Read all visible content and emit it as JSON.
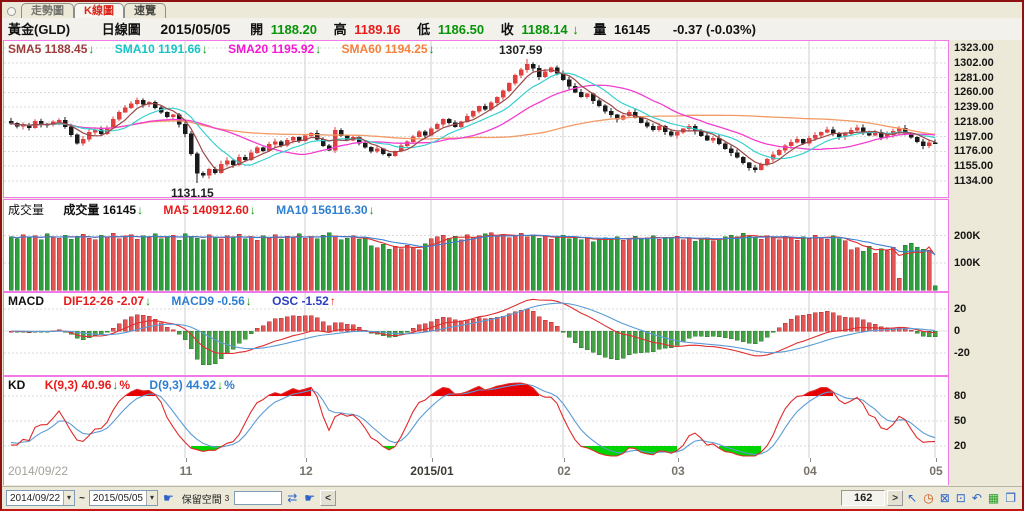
{
  "tabs": [
    {
      "label": "走勢圖",
      "active": false
    },
    {
      "label": "K線圖",
      "active": true
    },
    {
      "label": "速覽",
      "active": false
    }
  ],
  "header": {
    "symbol": "黃金(GLD)",
    "period": "日線圖",
    "date": "2015/05/05",
    "open_label": "開",
    "open": "1188.20",
    "high_label": "高",
    "high": "1189.16",
    "low_label": "低",
    "low": "1186.50",
    "close_label": "收",
    "close": "1188.14",
    "volume_label": "量",
    "volume": "16145",
    "change": "-0.37 (-0.03%)"
  },
  "arrows": {
    "down": "↓",
    "up": "↑"
  },
  "main_panel": {
    "sma5": "SMA5 1188.45",
    "sma10": "SMA10 1191.66",
    "sma20": "SMA20 1195.92",
    "sma60": "SMA60 1194.25",
    "high_annotation": "1307.59",
    "low_annotation": "1131.15",
    "price_ticks": [
      "1323.00",
      "1302.00",
      "1281.00",
      "1260.00",
      "1239.00",
      "1218.00",
      "1197.00",
      "1176.00",
      "1155.00",
      "1134.00"
    ]
  },
  "volume_panel": {
    "title": "成交量",
    "vol_label": "成交量 16145",
    "ma5_label": "MA5 140912.60",
    "ma10_label": "MA10 156116.30",
    "ticks": [
      "200K",
      "100K"
    ]
  },
  "macd_panel": {
    "title": "MACD",
    "dif_label": "DIF12-26 -2.07",
    "macd9_label": "MACD9 -0.56",
    "osc_label": "OSC -1.52",
    "ticks": [
      "20",
      "0",
      "-20"
    ]
  },
  "kd_panel": {
    "title": "KD",
    "k_label": "K(9,3) 40.96",
    "d_label": "D(9,3) 44.92",
    "pct": "%",
    "ticks": [
      "80",
      "50",
      "20"
    ]
  },
  "xaxis": {
    "start_label": "2014/09/22",
    "month_labels": [
      "11",
      "12",
      "2015/01",
      "02",
      "03",
      "04",
      "05"
    ]
  },
  "statusbar": {
    "date_from": "2014/09/22",
    "range_separator": "~",
    "date_to": "2015/05/05",
    "reserve_label": "保留空間",
    "reserve_superscript": "3",
    "back_button": "<",
    "bar_count": "162",
    "next_button": ">",
    "left_icons": [
      {
        "name": "hand-icon",
        "glyph": "☛",
        "color": "#2d62c9"
      },
      {
        "name": "swap-icon",
        "glyph": "⇄",
        "color": "#2d62c9"
      },
      {
        "name": "hand-icon-2",
        "glyph": "☛",
        "color": "#2d62c9"
      }
    ],
    "right_icons": [
      {
        "name": "cursor-icon",
        "glyph": "↖",
        "color": "#1d49c9"
      },
      {
        "name": "clock-icon",
        "glyph": "◷",
        "color": "#c9561d"
      },
      {
        "name": "zoom-out-icon",
        "glyph": "⊠",
        "color": "#1d49c9"
      },
      {
        "name": "zoom-in-icon",
        "glyph": "⊡",
        "color": "#1d49c9"
      },
      {
        "name": "undo-icon",
        "glyph": "↶",
        "color": "#1d49c9"
      },
      {
        "name": "chart-icon",
        "glyph": "▦",
        "color": "#259d25"
      },
      {
        "name": "copy-icon",
        "glyph": "❐",
        "color": "#1d49c9"
      }
    ]
  },
  "chart_data": {
    "type": "candlestick+volume+macd+kd",
    "title": "黃金(GLD) 日線圖",
    "date_range": [
      "2014/09/22",
      "2015/05/05"
    ],
    "price_axis": {
      "max": 1323,
      "min": 1134,
      "step": 21
    },
    "volume_ticks": [
      200,
      100
    ],
    "macd_ticks": [
      20,
      0,
      -20
    ],
    "kd_ticks": [
      80,
      50,
      20
    ],
    "high_marker": {
      "index": 86,
      "value": 1307.59
    },
    "low_marker": {
      "index": 31,
      "value": 1131.15
    },
    "month_tick_indices": [
      29,
      49,
      70,
      92,
      111,
      133,
      154
    ],
    "closes": [
      1216,
      1212,
      1214,
      1210,
      1219,
      1215,
      1214,
      1218,
      1220,
      1211,
      1200,
      1188,
      1193,
      1203,
      1207,
      1201,
      1210,
      1222,
      1232,
      1238,
      1244,
      1249,
      1243,
      1246,
      1238,
      1232,
      1225,
      1228,
      1215,
      1201,
      1173,
      1145,
      1142,
      1151,
      1146,
      1158,
      1163,
      1157,
      1168,
      1164,
      1174,
      1181,
      1177,
      1186,
      1190,
      1185,
      1192,
      1196,
      1191,
      1198,
      1202,
      1193,
      1184,
      1178,
      1206,
      1198,
      1192,
      1196,
      1188,
      1182,
      1176,
      1180,
      1173,
      1170,
      1176,
      1184,
      1190,
      1197,
      1204,
      1199,
      1208,
      1215,
      1222,
      1217,
      1211,
      1218,
      1226,
      1233,
      1240,
      1236,
      1245,
      1253,
      1262,
      1273,
      1284,
      1292,
      1300,
      1294,
      1282,
      1289,
      1295,
      1287,
      1278,
      1269,
      1260,
      1254,
      1258,
      1248,
      1241,
      1233,
      1228,
      1222,
      1227,
      1232,
      1224,
      1217,
      1212,
      1207,
      1212,
      1204,
      1199,
      1203,
      1208,
      1212,
      1205,
      1198,
      1192,
      1195,
      1187,
      1180,
      1174,
      1168,
      1160,
      1153,
      1150,
      1158,
      1165,
      1171,
      1178,
      1184,
      1189,
      1193,
      1188,
      1195,
      1199,
      1203,
      1207,
      1202,
      1197,
      1201,
      1206,
      1210,
      1204,
      1199,
      1203,
      1196,
      1200,
      1205,
      1209,
      1202,
      1196,
      1190,
      1184,
      1188.5,
      1188.14
    ],
    "volumes": [
      196,
      188,
      203,
      192,
      199,
      185,
      207,
      194,
      190,
      201,
      187,
      198,
      205,
      191,
      184,
      202,
      195,
      208,
      189,
      197,
      204,
      186,
      199,
      192,
      206,
      188,
      195,
      201,
      183,
      207,
      198,
      190,
      185,
      203,
      194,
      187,
      200,
      192,
      205,
      189,
      196,
      182,
      199,
      191,
      204,
      186,
      198,
      193,
      207,
      190,
      195,
      188,
      202,
      210,
      197,
      184,
      191,
      199,
      186,
      194,
      162,
      155,
      168,
      149,
      160,
      152,
      165,
      158,
      148,
      170,
      188,
      195,
      202,
      190,
      197,
      185,
      203,
      192,
      199,
      206,
      210,
      198,
      205,
      193,
      200,
      208,
      196,
      203,
      191,
      199,
      186,
      194,
      201,
      189,
      196,
      184,
      191,
      178,
      185,
      192,
      188,
      195,
      183,
      190,
      197,
      186,
      193,
      200,
      187,
      194,
      191,
      198,
      185,
      192,
      179,
      186,
      193,
      181,
      188,
      195,
      202,
      195,
      208,
      200,
      193,
      187,
      199,
      192,
      185,
      198,
      190,
      183,
      196,
      189,
      202,
      194,
      187,
      200,
      188,
      181,
      148,
      155,
      142,
      160,
      136,
      152,
      145,
      158,
      44,
      165,
      172,
      158,
      150,
      146,
      16
    ],
    "colors": {
      "up": "#e23f3f",
      "down": "#1a1a1a",
      "vol_up": "#e25555",
      "vol_down": "#2f9e3f",
      "sma5": "#9c4747",
      "sma10": "#39d0d0",
      "sma20": "#f23fd0",
      "sma60": "#f39a66",
      "ma5": "#e03030",
      "ma10": "#3b82d6",
      "macd_pos": "#e05555",
      "macd_neg": "#46a046",
      "dif": "#e03030",
      "dea": "#5b9bd5",
      "k": "#e02a2a",
      "d": "#5b9bd5",
      "fill_high": "#e60000",
      "fill_low": "#00d400"
    }
  }
}
